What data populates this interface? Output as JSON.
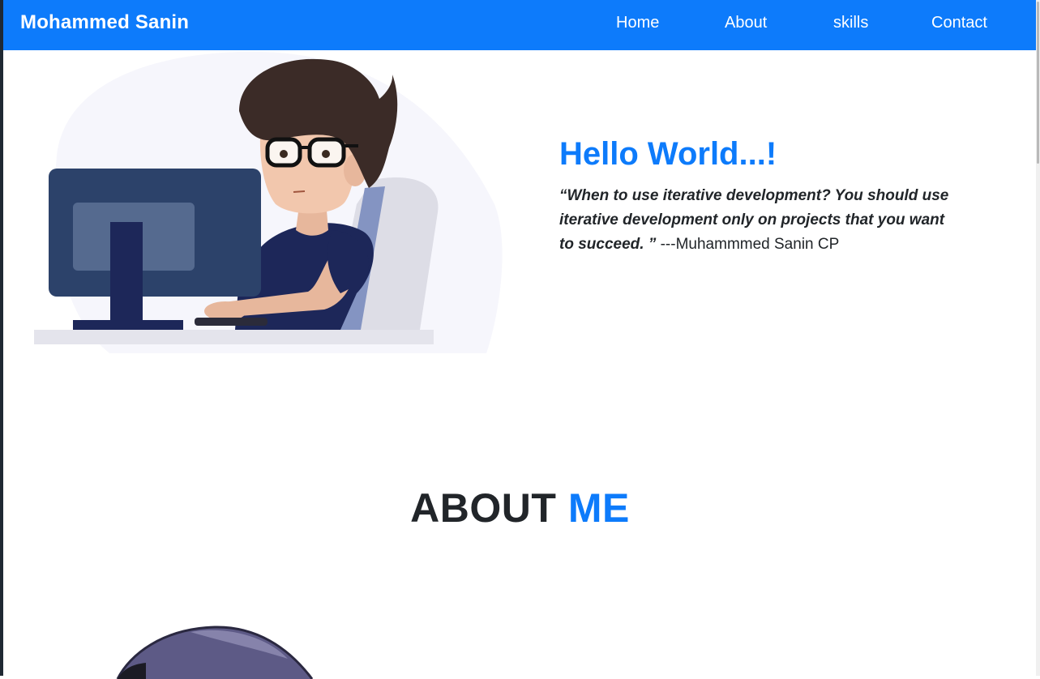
{
  "navbar": {
    "brand": "Mohammed Sanin",
    "links": [
      "Home",
      "About",
      "skills",
      "Contact"
    ]
  },
  "hero": {
    "title": "Hello World...!",
    "quote": "“When to use iterative development? You should use iterative development only on projects that you want to succeed. ”",
    "author": " ---Muhammmed Sanin CP",
    "illustration": "developer-at-computer-illustration"
  },
  "about": {
    "heading_part1": "ABOUT ",
    "heading_part2": "ME",
    "avatar": "developer-avatar-cap"
  },
  "colors": {
    "accent": "#0d7bfb",
    "text": "#212529",
    "background": "#ffffff"
  }
}
